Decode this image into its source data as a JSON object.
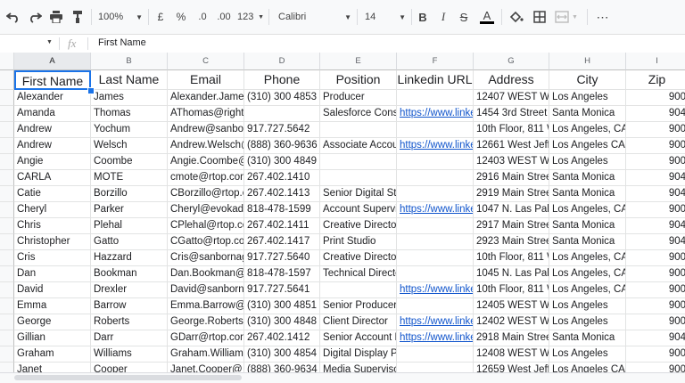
{
  "toolbar": {
    "zoom": "100%",
    "currency": "£",
    "percent": "%",
    "dec_decrease": ".0",
    "dec_increase": ".00",
    "format_more": "123",
    "font": "Calibri",
    "font_size": "14",
    "bold": "B",
    "italic": "I",
    "strike": "S",
    "text_color": "A"
  },
  "formula_bar": {
    "fx": "fx",
    "value": "First Name"
  },
  "columns": [
    "A",
    "B",
    "C",
    "D",
    "E",
    "F",
    "G",
    "H",
    "I"
  ],
  "headers": [
    "First Name",
    "Last Name",
    "Email",
    "Phone",
    "Position",
    "Linkedin URL",
    "Address",
    "City",
    "Zip"
  ],
  "rows": [
    [
      "Alexander",
      "James",
      "Alexander.James",
      "(310) 300 4853",
      "Producer",
      "",
      "12407 WEST W",
      "Los Angeles",
      "900"
    ],
    [
      "Amanda",
      "Thomas",
      "AThomas@rightpoint.com",
      "",
      "Salesforce Cons",
      "https://www.linke",
      "1454 3rd Street",
      "Santa Monica",
      "904"
    ],
    [
      "Andrew",
      "Yochum",
      "Andrew@sanbor",
      "917.727.5642",
      "",
      "",
      "10th Floor, 811 W",
      "Los Angeles, CA",
      "900"
    ],
    [
      "Andrew",
      "Welsch",
      "Andrew.Welsch@",
      "(888) 360-9636",
      "Associate Accou",
      "https://www.linke",
      "12661 West Jeff",
      "Los Angeles CA",
      "900"
    ],
    [
      "Angie",
      "Coombe",
      "Angie.Coombe@",
      "(310) 300 4849",
      "",
      "",
      "12403 WEST W",
      "Los Angeles",
      "900"
    ],
    [
      "CARLA",
      "MOTE",
      "cmote@rtop.com",
      "267.402.1410",
      "",
      "",
      "2916 Main Stree",
      "Santa Monica",
      "904"
    ],
    [
      "Catie",
      "Borzillo",
      "CBorzillo@rtop.c",
      "267.402.1413",
      "Senior Digital Strategist",
      "",
      "2919 Main Stree",
      "Santa Monica",
      "904"
    ],
    [
      "Cheryl",
      "Parker",
      "Cheryl@evokad.",
      "818-478-1599",
      "Account Supervi",
      "https://www.linke",
      "1047 N. Las Pal",
      "Los Angeles, CA",
      "900"
    ],
    [
      "Chris",
      "Plehal",
      "CPlehal@rtop.co",
      "267.402.1411",
      "Creative Director",
      "",
      "2917 Main Stree",
      "Santa Monica",
      "904"
    ],
    [
      "Christopher",
      "Gatto",
      "CGatto@rtop.co",
      "267.402.1417",
      "Print Studio",
      "",
      "2923 Main Stree",
      "Santa Monica",
      "904"
    ],
    [
      "Cris",
      "Hazzard",
      "Cris@sanbornag",
      "917.727.5640",
      "Creative Director",
      "",
      "10th Floor, 811 W",
      "Los Angeles, CA",
      "900"
    ],
    [
      "Dan",
      "Bookman",
      "Dan.Bookman@",
      "818-478-1597",
      "Technical Director",
      "",
      "1045 N. Las Pal",
      "Los Angeles, CA",
      "900"
    ],
    [
      "David",
      "Drexler",
      "David@sanborn",
      "917.727.5641",
      "",
      "https://www.linke",
      "10th Floor, 811 W",
      "Los Angeles, CA",
      "900"
    ],
    [
      "Emma",
      "Barrow",
      "Emma.Barrow@",
      "(310) 300 4851",
      "Senior Producer",
      "",
      "12405 WEST W",
      "Los Angeles",
      "900"
    ],
    [
      "George",
      "Roberts",
      "George.Roberts",
      "(310) 300 4848",
      "Client Director",
      "https://www.linke",
      "12402 WEST W",
      "Los Angeles",
      "900"
    ],
    [
      "Gillian",
      "Darr",
      "GDarr@rtop.con",
      "267.402.1412",
      "Senior Account N",
      "https://www.linke",
      "2918 Main Stree",
      "Santa Monica",
      "904"
    ],
    [
      "Graham",
      "Williams",
      "Graham.Williams",
      "(310) 300 4854",
      "Digital Display Producer and Proje",
      "",
      "12408 WEST W",
      "Los Angeles",
      "900"
    ],
    [
      "Janet",
      "Cooper",
      "Janet.Cooper@",
      "(888) 360-9634",
      "Media Supervisor",
      "",
      "12659 West Jeff",
      "Los Angeles CA",
      "900"
    ]
  ]
}
